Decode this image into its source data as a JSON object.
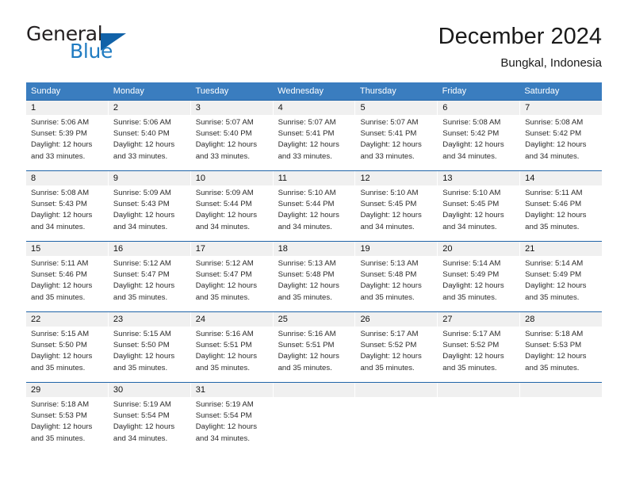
{
  "brand": {
    "name_top": "General",
    "name_bottom": "Blue",
    "triangle_color": "#1162a8",
    "blue_color": "#1f7bc1"
  },
  "header": {
    "title": "December 2024",
    "location": "Bungkal, Indonesia"
  },
  "theme": {
    "header_row_bg": "#3a7dbf",
    "row_top_border": "#1f64a8",
    "day_number_bg": "#f0f0f0",
    "text_color": "#2b2b2b"
  },
  "weekdays": [
    "Sunday",
    "Monday",
    "Tuesday",
    "Wednesday",
    "Thursday",
    "Friday",
    "Saturday"
  ],
  "weeks": [
    [
      {
        "day": "1",
        "sunrise": "Sunrise: 5:06 AM",
        "sunset": "Sunset: 5:39 PM",
        "daylight_line1": "Daylight: 12 hours",
        "daylight_line2": "and 33 minutes."
      },
      {
        "day": "2",
        "sunrise": "Sunrise: 5:06 AM",
        "sunset": "Sunset: 5:40 PM",
        "daylight_line1": "Daylight: 12 hours",
        "daylight_line2": "and 33 minutes."
      },
      {
        "day": "3",
        "sunrise": "Sunrise: 5:07 AM",
        "sunset": "Sunset: 5:40 PM",
        "daylight_line1": "Daylight: 12 hours",
        "daylight_line2": "and 33 minutes."
      },
      {
        "day": "4",
        "sunrise": "Sunrise: 5:07 AM",
        "sunset": "Sunset: 5:41 PM",
        "daylight_line1": "Daylight: 12 hours",
        "daylight_line2": "and 33 minutes."
      },
      {
        "day": "5",
        "sunrise": "Sunrise: 5:07 AM",
        "sunset": "Sunset: 5:41 PM",
        "daylight_line1": "Daylight: 12 hours",
        "daylight_line2": "and 33 minutes."
      },
      {
        "day": "6",
        "sunrise": "Sunrise: 5:08 AM",
        "sunset": "Sunset: 5:42 PM",
        "daylight_line1": "Daylight: 12 hours",
        "daylight_line2": "and 34 minutes."
      },
      {
        "day": "7",
        "sunrise": "Sunrise: 5:08 AM",
        "sunset": "Sunset: 5:42 PM",
        "daylight_line1": "Daylight: 12 hours",
        "daylight_line2": "and 34 minutes."
      }
    ],
    [
      {
        "day": "8",
        "sunrise": "Sunrise: 5:08 AM",
        "sunset": "Sunset: 5:43 PM",
        "daylight_line1": "Daylight: 12 hours",
        "daylight_line2": "and 34 minutes."
      },
      {
        "day": "9",
        "sunrise": "Sunrise: 5:09 AM",
        "sunset": "Sunset: 5:43 PM",
        "daylight_line1": "Daylight: 12 hours",
        "daylight_line2": "and 34 minutes."
      },
      {
        "day": "10",
        "sunrise": "Sunrise: 5:09 AM",
        "sunset": "Sunset: 5:44 PM",
        "daylight_line1": "Daylight: 12 hours",
        "daylight_line2": "and 34 minutes."
      },
      {
        "day": "11",
        "sunrise": "Sunrise: 5:10 AM",
        "sunset": "Sunset: 5:44 PM",
        "daylight_line1": "Daylight: 12 hours",
        "daylight_line2": "and 34 minutes."
      },
      {
        "day": "12",
        "sunrise": "Sunrise: 5:10 AM",
        "sunset": "Sunset: 5:45 PM",
        "daylight_line1": "Daylight: 12 hours",
        "daylight_line2": "and 34 minutes."
      },
      {
        "day": "13",
        "sunrise": "Sunrise: 5:10 AM",
        "sunset": "Sunset: 5:45 PM",
        "daylight_line1": "Daylight: 12 hours",
        "daylight_line2": "and 34 minutes."
      },
      {
        "day": "14",
        "sunrise": "Sunrise: 5:11 AM",
        "sunset": "Sunset: 5:46 PM",
        "daylight_line1": "Daylight: 12 hours",
        "daylight_line2": "and 35 minutes."
      }
    ],
    [
      {
        "day": "15",
        "sunrise": "Sunrise: 5:11 AM",
        "sunset": "Sunset: 5:46 PM",
        "daylight_line1": "Daylight: 12 hours",
        "daylight_line2": "and 35 minutes."
      },
      {
        "day": "16",
        "sunrise": "Sunrise: 5:12 AM",
        "sunset": "Sunset: 5:47 PM",
        "daylight_line1": "Daylight: 12 hours",
        "daylight_line2": "and 35 minutes."
      },
      {
        "day": "17",
        "sunrise": "Sunrise: 5:12 AM",
        "sunset": "Sunset: 5:47 PM",
        "daylight_line1": "Daylight: 12 hours",
        "daylight_line2": "and 35 minutes."
      },
      {
        "day": "18",
        "sunrise": "Sunrise: 5:13 AM",
        "sunset": "Sunset: 5:48 PM",
        "daylight_line1": "Daylight: 12 hours",
        "daylight_line2": "and 35 minutes."
      },
      {
        "day": "19",
        "sunrise": "Sunrise: 5:13 AM",
        "sunset": "Sunset: 5:48 PM",
        "daylight_line1": "Daylight: 12 hours",
        "daylight_line2": "and 35 minutes."
      },
      {
        "day": "20",
        "sunrise": "Sunrise: 5:14 AM",
        "sunset": "Sunset: 5:49 PM",
        "daylight_line1": "Daylight: 12 hours",
        "daylight_line2": "and 35 minutes."
      },
      {
        "day": "21",
        "sunrise": "Sunrise: 5:14 AM",
        "sunset": "Sunset: 5:49 PM",
        "daylight_line1": "Daylight: 12 hours",
        "daylight_line2": "and 35 minutes."
      }
    ],
    [
      {
        "day": "22",
        "sunrise": "Sunrise: 5:15 AM",
        "sunset": "Sunset: 5:50 PM",
        "daylight_line1": "Daylight: 12 hours",
        "daylight_line2": "and 35 minutes."
      },
      {
        "day": "23",
        "sunrise": "Sunrise: 5:15 AM",
        "sunset": "Sunset: 5:50 PM",
        "daylight_line1": "Daylight: 12 hours",
        "daylight_line2": "and 35 minutes."
      },
      {
        "day": "24",
        "sunrise": "Sunrise: 5:16 AM",
        "sunset": "Sunset: 5:51 PM",
        "daylight_line1": "Daylight: 12 hours",
        "daylight_line2": "and 35 minutes."
      },
      {
        "day": "25",
        "sunrise": "Sunrise: 5:16 AM",
        "sunset": "Sunset: 5:51 PM",
        "daylight_line1": "Daylight: 12 hours",
        "daylight_line2": "and 35 minutes."
      },
      {
        "day": "26",
        "sunrise": "Sunrise: 5:17 AM",
        "sunset": "Sunset: 5:52 PM",
        "daylight_line1": "Daylight: 12 hours",
        "daylight_line2": "and 35 minutes."
      },
      {
        "day": "27",
        "sunrise": "Sunrise: 5:17 AM",
        "sunset": "Sunset: 5:52 PM",
        "daylight_line1": "Daylight: 12 hours",
        "daylight_line2": "and 35 minutes."
      },
      {
        "day": "28",
        "sunrise": "Sunrise: 5:18 AM",
        "sunset": "Sunset: 5:53 PM",
        "daylight_line1": "Daylight: 12 hours",
        "daylight_line2": "and 35 minutes."
      }
    ],
    [
      {
        "day": "29",
        "sunrise": "Sunrise: 5:18 AM",
        "sunset": "Sunset: 5:53 PM",
        "daylight_line1": "Daylight: 12 hours",
        "daylight_line2": "and 35 minutes."
      },
      {
        "day": "30",
        "sunrise": "Sunrise: 5:19 AM",
        "sunset": "Sunset: 5:54 PM",
        "daylight_line1": "Daylight: 12 hours",
        "daylight_line2": "and 34 minutes."
      },
      {
        "day": "31",
        "sunrise": "Sunrise: 5:19 AM",
        "sunset": "Sunset: 5:54 PM",
        "daylight_line1": "Daylight: 12 hours",
        "daylight_line2": "and 34 minutes."
      },
      {
        "day": "",
        "sunrise": "",
        "sunset": "",
        "daylight_line1": "",
        "daylight_line2": ""
      },
      {
        "day": "",
        "sunrise": "",
        "sunset": "",
        "daylight_line1": "",
        "daylight_line2": ""
      },
      {
        "day": "",
        "sunrise": "",
        "sunset": "",
        "daylight_line1": "",
        "daylight_line2": ""
      },
      {
        "day": "",
        "sunrise": "",
        "sunset": "",
        "daylight_line1": "",
        "daylight_line2": ""
      }
    ]
  ]
}
